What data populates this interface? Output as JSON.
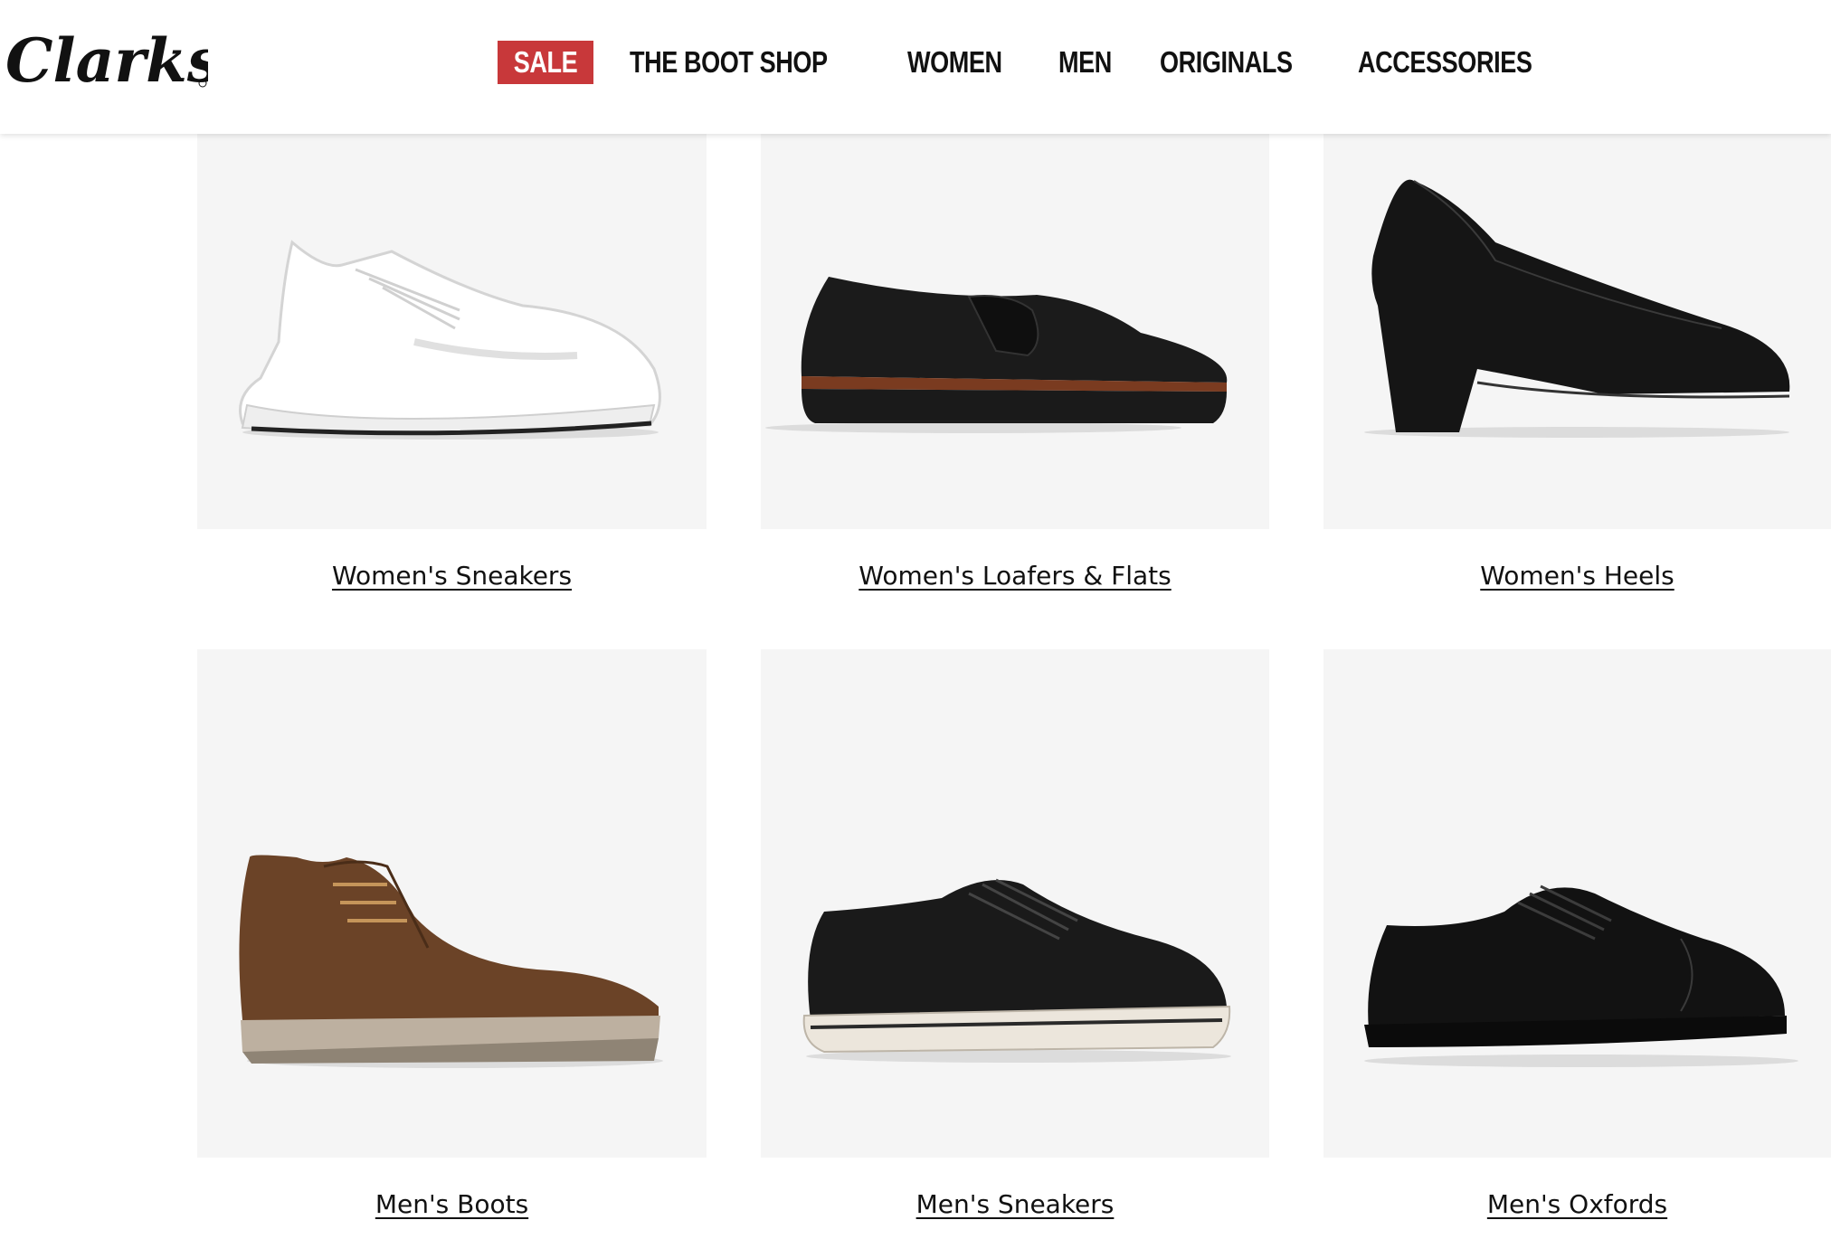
{
  "brand": {
    "name": "Clarks"
  },
  "nav": {
    "sale": "SALE",
    "items": [
      "THE BOOT SHOP",
      "WOMEN",
      "MEN",
      "ORIGINALS",
      "ACCESSORIES"
    ]
  },
  "colors": {
    "sale_bg": "#c8383a",
    "tile_bg": "#f5f5f5",
    "text": "#111111"
  },
  "categories": [
    {
      "label": "Women's Sneakers",
      "icon": "white-sneaker-image"
    },
    {
      "label": "Women's Loafers & Flats",
      "icon": "black-loafer-image"
    },
    {
      "label": "Women's Heels",
      "icon": "black-heel-pump-image"
    },
    {
      "label": "Men's Boots",
      "icon": "brown-chukka-boot-image"
    },
    {
      "label": "Men's Sneakers",
      "icon": "black-sneaker-image"
    },
    {
      "label": "Men's Oxfords",
      "icon": "black-oxford-image"
    }
  ]
}
